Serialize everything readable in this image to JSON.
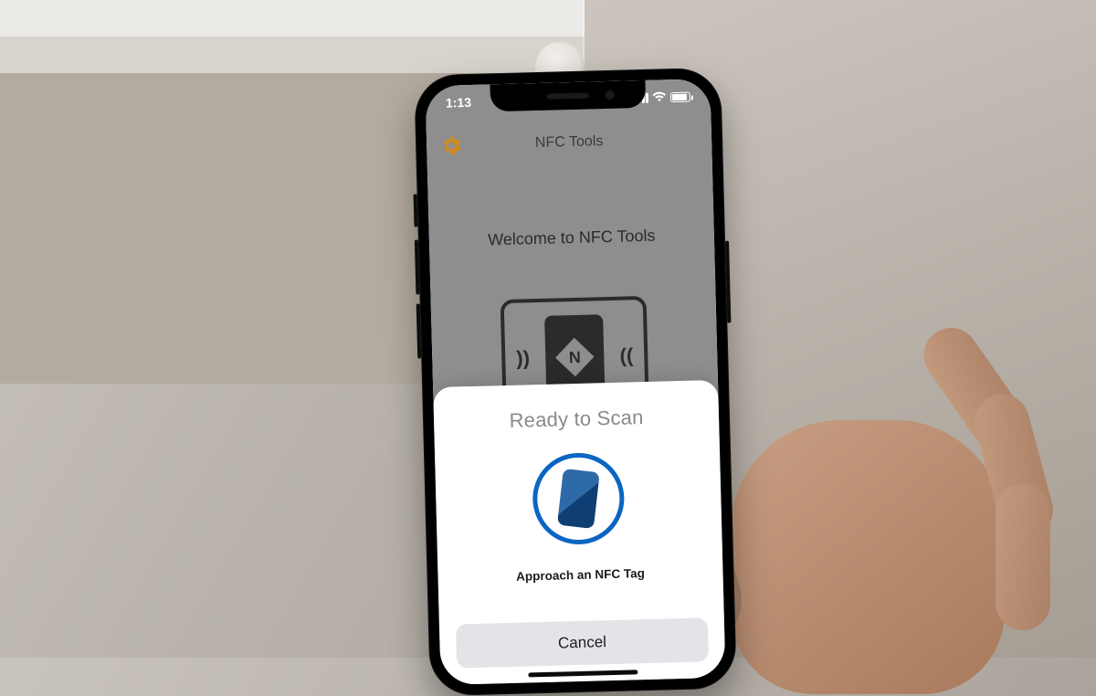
{
  "status": {
    "time": "1:13"
  },
  "navbar": {
    "title": "NFC Tools"
  },
  "main": {
    "welcome": "Welcome to NFC Tools",
    "logo_letter": "N"
  },
  "scan_sheet": {
    "title": "Ready to Scan",
    "message": "Approach an NFC Tag",
    "cancel": "Cancel"
  }
}
